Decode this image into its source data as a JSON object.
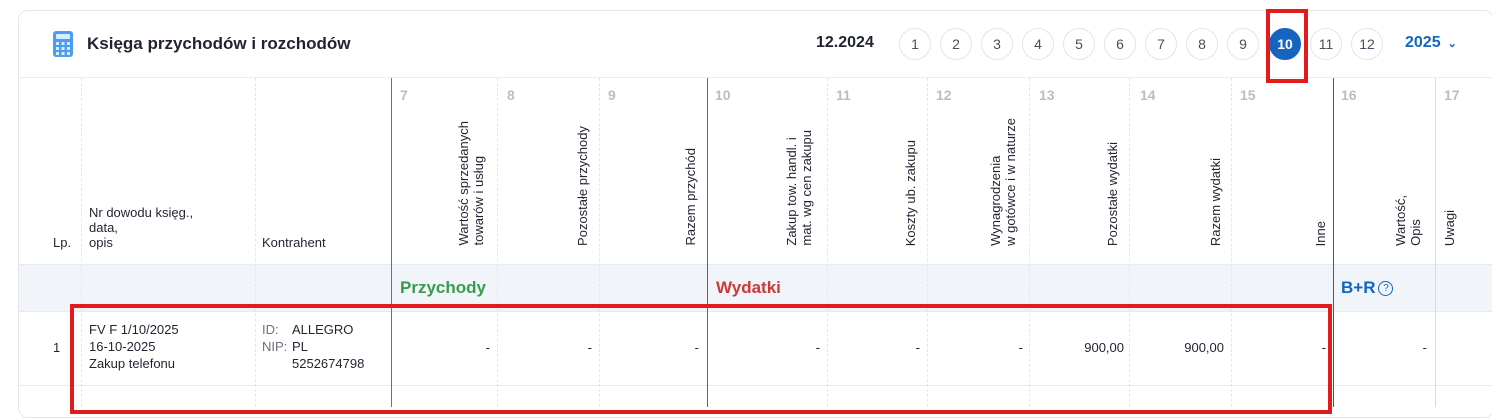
{
  "header": {
    "title": "Księga przychodów i rozchodów",
    "period": "12.2024",
    "months": [
      "1",
      "2",
      "3",
      "4",
      "5",
      "6",
      "7",
      "8",
      "9",
      "10",
      "11",
      "12"
    ],
    "active_month": "10",
    "year": "2025",
    "accent_color": "#1565c0"
  },
  "columns": {
    "lp": "Lp.",
    "doc": [
      "Nr dowodu księg.,",
      "data,",
      "opis"
    ],
    "contractor": "Kontrahent",
    "c7": {
      "num": "7",
      "label": "Wartość sprzedanych\ntowarów i usług"
    },
    "c8": {
      "num": "8",
      "label": "Pozostałe przychody"
    },
    "c9": {
      "num": "9",
      "label": "Razem przychód"
    },
    "c10": {
      "num": "10",
      "label": "Zakup tow. handl. i\nmat. wg cen zakupu"
    },
    "c11": {
      "num": "11",
      "label": "Koszty ub. zakupu"
    },
    "c12": {
      "num": "12",
      "label": "Wynagrodzenia\nw gotówce i w naturze"
    },
    "c13": {
      "num": "13",
      "label": "Pozostałe wydatki"
    },
    "c14": {
      "num": "14",
      "label": "Razem wydatki"
    },
    "c15": {
      "num": "15",
      "label": "Inne"
    },
    "c16": {
      "num": "16",
      "label": "Wartość,\nOpis"
    },
    "c17": {
      "num": "17",
      "label": "Uwagi"
    }
  },
  "sections": {
    "income": "Przychody",
    "income_color": "#3a9a4e",
    "expenses": "Wydatki",
    "expenses_color": "#c83b3b",
    "br": "B+R",
    "br_help": "?"
  },
  "rows": [
    {
      "lp": "1",
      "doc_number": "FV F 1/10/2025",
      "date": "16-10-2025",
      "description": "Zakup telefonu",
      "id_label": "ID:",
      "id_value": "ALLEGRO",
      "nip_label": "NIP:",
      "nip_value": "PL",
      "nip_number": "5252674798",
      "c7": "-",
      "c8": "-",
      "c9": "-",
      "c10": "-",
      "c11": "-",
      "c12": "-",
      "c13": "900,00",
      "c14": "900,00",
      "c15": "-",
      "c16": "-"
    }
  ]
}
